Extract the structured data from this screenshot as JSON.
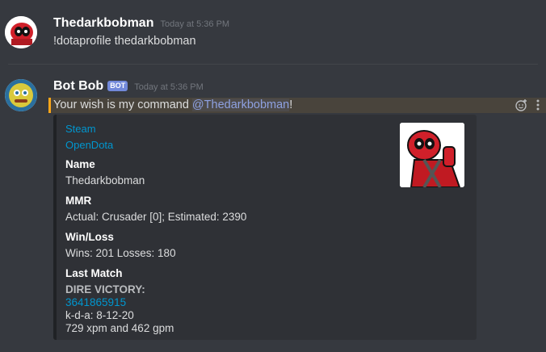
{
  "messages": [
    {
      "author": "Thedarkbobman",
      "timestamp": "Today at 5:36 PM",
      "text": "!dotaprofile thedarkbobman"
    },
    {
      "author": "Bot Bob",
      "bot_tag": "BOT",
      "timestamp": "Today at 5:36 PM",
      "text_before": "Your wish is my command ",
      "mention": "@Thedarkbobman",
      "text_after": "!"
    }
  ],
  "embed": {
    "link_steam": "Steam",
    "link_opendota": "OpenDota",
    "fields": {
      "name": {
        "name": "Name",
        "value": "Thedarkbobman"
      },
      "mmr": {
        "name": "MMR",
        "value": "Actual: Crusader [0]; Estimated: 2390"
      },
      "winloss": {
        "name": "Win/Loss",
        "value": "Wins: 201 Losses: 180"
      },
      "last_match": {
        "name": "Last Match",
        "result": "DIRE VICTORY:",
        "match_id": "3641865915",
        "kda": "k-d-a: 8-12-20",
        "xpm_gpm": "729 xpm and 462 gpm"
      }
    }
  },
  "icons": {
    "add_reaction": "add-reaction-icon",
    "more": "more-options-icon"
  },
  "colors": {
    "background": "#36393f",
    "embed_background": "#2f3136",
    "link": "#0096cf",
    "mention": "#8ea1e1",
    "bot_tag": "#7289da",
    "highlight_bar": "#faa61a"
  }
}
